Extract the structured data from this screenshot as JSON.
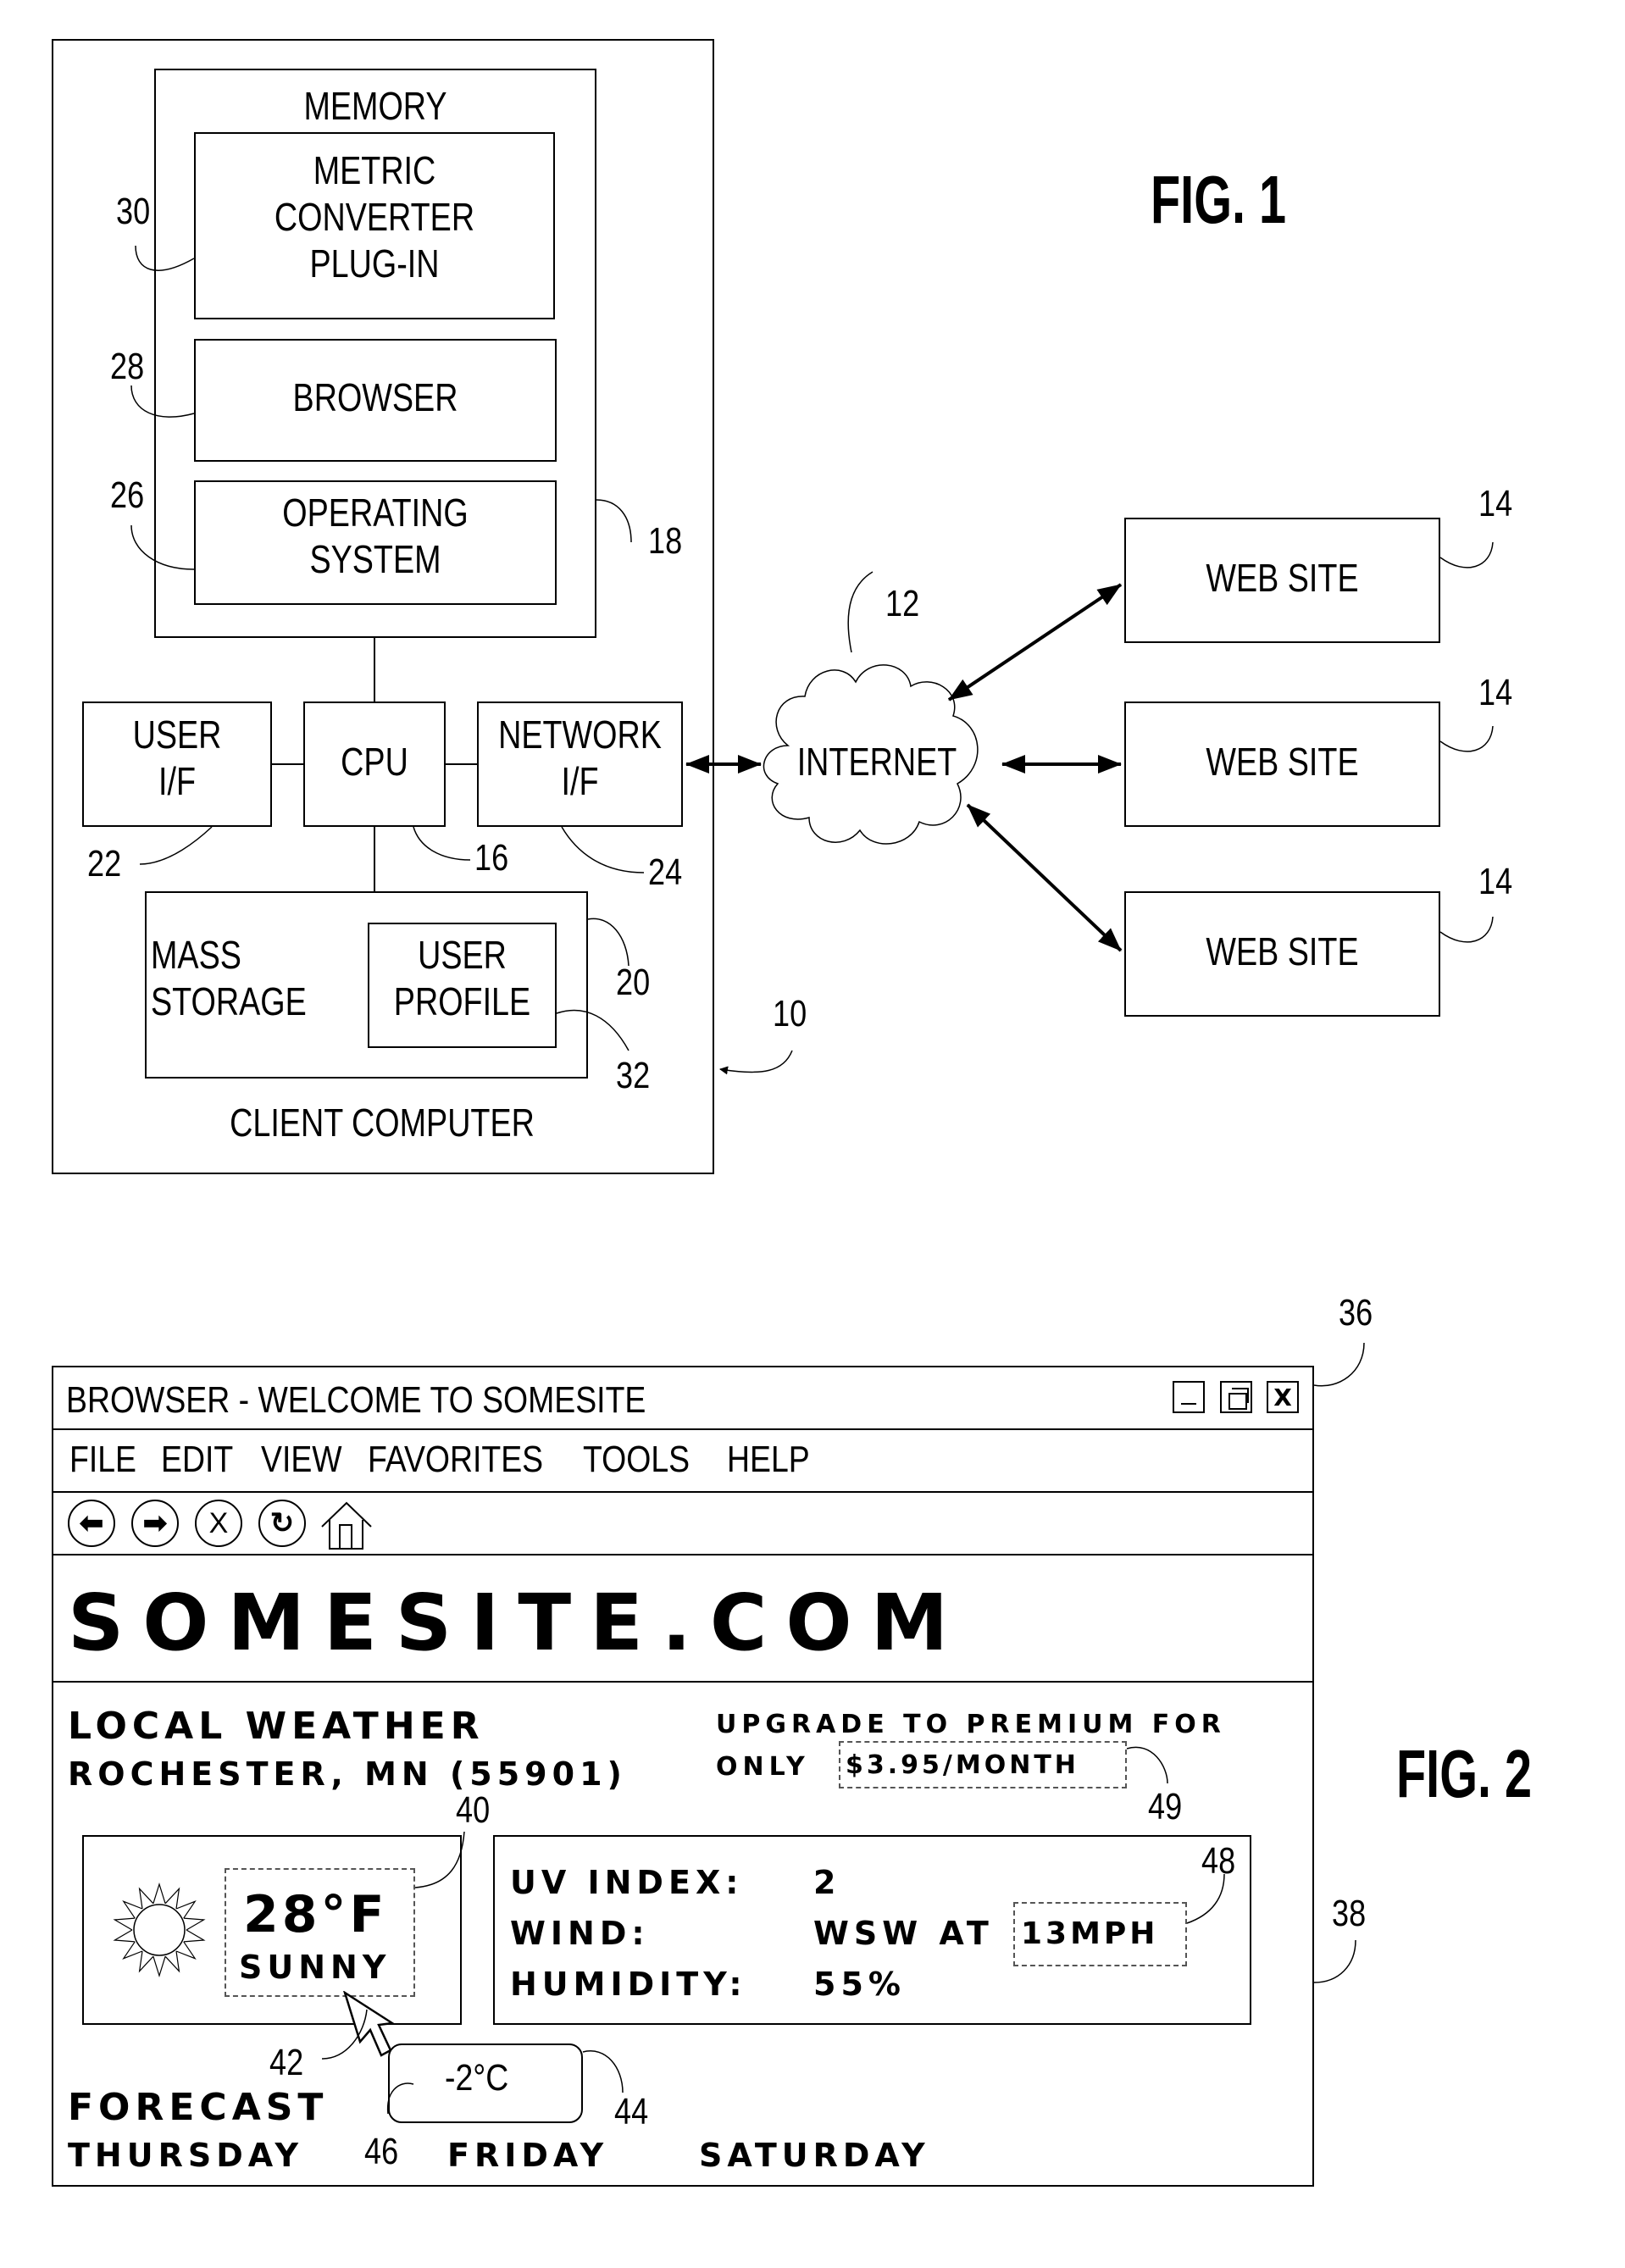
{
  "fig1": {
    "title": "FIG. 1",
    "client_computer": {
      "label": "CLIENT COMPUTER",
      "ref": "10"
    },
    "memory": {
      "label": "MEMORY",
      "ref": "18"
    },
    "metric_converter": {
      "label": "METRIC\nCONVERTER\nPLUG-IN",
      "ref": "30"
    },
    "browser": {
      "label": "BROWSER",
      "ref": "28"
    },
    "operating_system": {
      "label": "OPERATING\nSYSTEM",
      "ref": "26"
    },
    "user_if": {
      "label": "USER\nI/F",
      "ref": "22"
    },
    "cpu": {
      "label": "CPU",
      "ref": "16"
    },
    "network_if": {
      "label": "NETWORK\nI/F",
      "ref": "24"
    },
    "mass_storage": {
      "label": "MASS\nSTORAGE",
      "ref": "20"
    },
    "user_profile": {
      "label": "USER\nPROFILE",
      "ref": "32"
    },
    "internet": {
      "label": "INTERNET",
      "ref": "12"
    },
    "web_sites": [
      {
        "label": "WEB SITE",
        "ref": "14"
      },
      {
        "label": "WEB SITE",
        "ref": "14"
      },
      {
        "label": "WEB SITE",
        "ref": "14"
      }
    ]
  },
  "fig2": {
    "title": "FIG. 2",
    "window_ref": "36",
    "content_ref": "38",
    "window": {
      "title": "BROWSER - WELCOME TO SOMESITE",
      "controls": {
        "minimize": "_",
        "close": "X"
      },
      "menu": [
        "FILE",
        "EDIT",
        "VIEW",
        "FAVORITES",
        "TOOLS",
        "HELP"
      ],
      "toolbar_icons": [
        "back-icon",
        "forward-icon",
        "stop-icon",
        "refresh-icon",
        "home-icon"
      ],
      "stop_glyph": "X"
    },
    "site": {
      "logo": "SOMESITE.COM",
      "heading": "LOCAL WEATHER",
      "location": "ROCHESTER, MN (55901)",
      "promo_line1": "UPGRADE TO PREMIUM FOR",
      "promo_only": "ONLY",
      "promo_price": "$3.95/MONTH",
      "promo_ref": "49",
      "current": {
        "temperature": "28°F",
        "condition": "SUNNY",
        "ref": "40",
        "cursor_ref": "42"
      },
      "details": {
        "ref": "48",
        "rows": [
          {
            "label": "UV INDEX:",
            "value": "2"
          },
          {
            "label": "WIND:",
            "value": "WSW AT",
            "highlight": "13MPH"
          },
          {
            "label": "HUMIDITY:",
            "value": "55%"
          }
        ]
      },
      "tooltip": {
        "text": "-2°C",
        "ref": "44",
        "pointer_ref": "46"
      },
      "forecast": {
        "label": "FORECAST",
        "days": [
          "THURSDAY",
          "FRIDAY",
          "SATURDAY"
        ]
      }
    }
  }
}
